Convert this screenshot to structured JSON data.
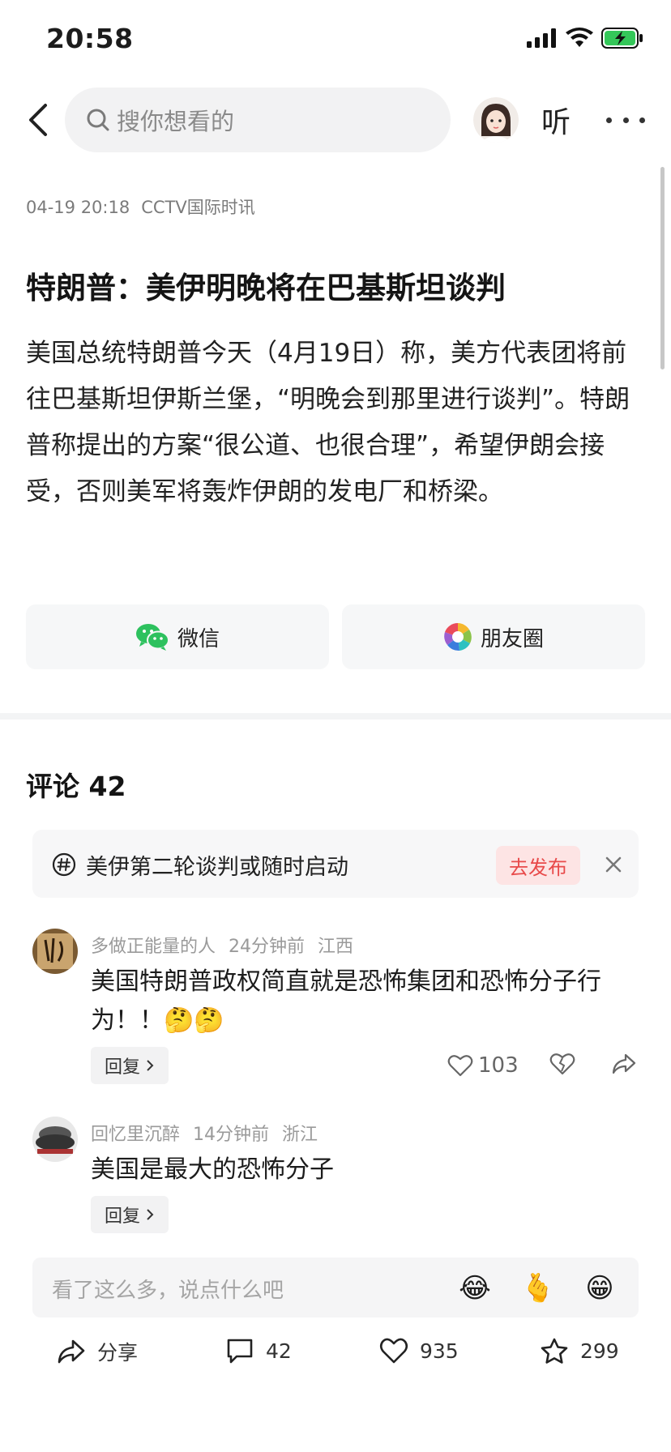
{
  "status_bar": {
    "time": "20:58"
  },
  "nav": {
    "search_placeholder": "搜你想看的",
    "listen_label": "听"
  },
  "article": {
    "date": "04-19 20:18",
    "source": "CCTV国际时讯",
    "title": "特朗普：美伊明晚将在巴基斯坦谈判",
    "body": "美国总统特朗普今天（4月19日）称，美方代表团将前往巴基斯坦伊斯兰堡，“明晚会到那里进行谈判”。特朗普称提出的方案“很公道、也很合理”，希望伊朗会接受，否则美军将轰炸伊朗的发电厂和桥梁。"
  },
  "share": {
    "wechat_label": "微信",
    "moments_label": "朋友圈"
  },
  "comments_section": {
    "title": "评论 42",
    "topic": {
      "text": "美伊第二轮谈判或随时启动",
      "publish_label": "去发布"
    },
    "items": [
      {
        "user": "多做正能量的人",
        "time": "24分钟前",
        "location": "江西",
        "text": "美国特朗普政权简直就是恐怖集团和恐怖分子行为！！🤔🤔",
        "reply_label": "回复",
        "likes": "103"
      },
      {
        "user": "回忆里沉醉",
        "time": "14分钟前",
        "location": "浙江",
        "text": "美国是最大的恐怖分子",
        "reply_label": "回复"
      }
    ]
  },
  "input_bar": {
    "placeholder": "看了这么多，说点什么吧",
    "emojis": [
      "😂",
      "🫰",
      "😁"
    ]
  },
  "bottom_bar": {
    "share_label": "分享",
    "comments_count": "42",
    "likes_count": "935",
    "favorites_count": "299"
  },
  "colors": {
    "accent_red": "#e84a4a",
    "wechat_green": "#2dc15e",
    "text_primary": "#1c1c1c",
    "text_secondary": "#9a9a9a"
  }
}
